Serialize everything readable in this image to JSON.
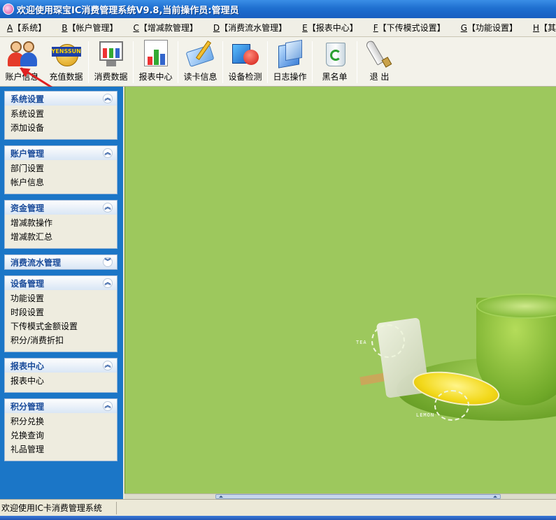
{
  "window": {
    "title": "欢迎使用琛宝IC消费管理系统V9.8,当前操作员:管理员"
  },
  "menu": [
    {
      "key": "A",
      "label": "【系统】"
    },
    {
      "key": "B",
      "label": "【帐户管理】"
    },
    {
      "key": "C",
      "label": "【增减款管理】"
    },
    {
      "key": "D",
      "label": "【消费流水管理】"
    },
    {
      "key": "E",
      "label": "【报表中心】"
    },
    {
      "key": "F",
      "label": "【下传模式设置】"
    },
    {
      "key": "G",
      "label": "【功能设置】"
    },
    {
      "key": "H",
      "label": "【其他工具】"
    }
  ],
  "toolbar": [
    {
      "label": "账户信息",
      "icon": "users-icon"
    },
    {
      "label": "充值数据",
      "icon": "recharge-icon",
      "badge": "YENSSUN"
    },
    {
      "label": "消费数据",
      "icon": "consume-data-icon"
    },
    {
      "label": "报表中心",
      "icon": "report-chart-icon"
    },
    {
      "label": "读卡信息",
      "icon": "read-card-icon"
    },
    {
      "label": "设备检测",
      "icon": "device-check-icon"
    },
    {
      "label": "日志操作",
      "icon": "log-icon"
    },
    {
      "label": "黑名单",
      "icon": "blacklist-icon"
    },
    {
      "label": "退 出",
      "icon": "exit-icon"
    }
  ],
  "sidebar": {
    "panels": [
      {
        "title": "系统设置",
        "collapsed": false,
        "items": [
          "系统设置",
          "添加设备"
        ]
      },
      {
        "title": "账户管理",
        "collapsed": false,
        "items": [
          "部门设置",
          "帐户信息"
        ]
      },
      {
        "title": "资金管理",
        "collapsed": false,
        "items": [
          "增减款操作",
          "增减款汇总"
        ]
      },
      {
        "title": "消费流水管理",
        "collapsed": true,
        "items": []
      },
      {
        "title": "设备管理",
        "collapsed": false,
        "items": [
          "功能设置",
          "时段设置",
          "下传模式金额设置",
          "积分/消费折扣"
        ]
      },
      {
        "title": "报表中心",
        "collapsed": false,
        "items": [
          "报表中心"
        ]
      },
      {
        "title": "积分管理",
        "collapsed": false,
        "items": [
          "积分兑换",
          "兑换查询",
          "礼品管理"
        ]
      }
    ]
  },
  "main": {
    "background_color": "#9dc85d",
    "labels": {
      "tea": "TEA",
      "lemon": "LEMON"
    }
  },
  "statusbar": {
    "text": "欢迎使用IC卡消费管理系统"
  },
  "colors": {
    "sidebar_bg": "#1b76c7",
    "panel_title": "#1a4b9a",
    "accent_red": "#e02020"
  }
}
